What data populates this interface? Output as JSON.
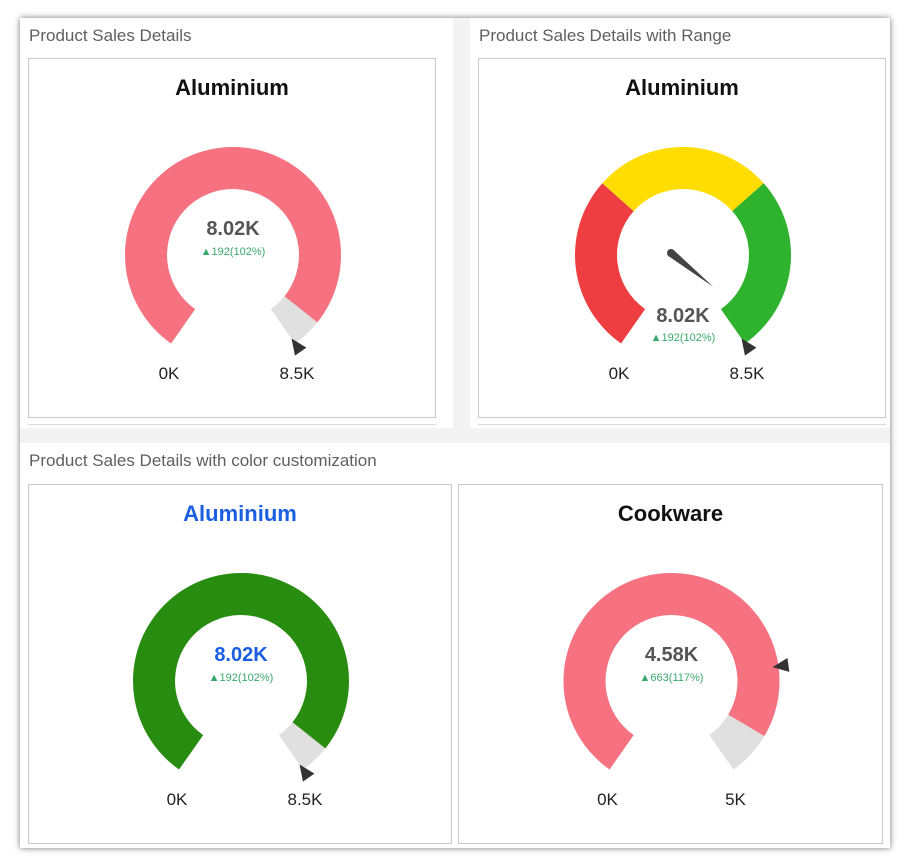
{
  "sections": [
    {
      "title": "Product Sales Details"
    },
    {
      "title": "Product Sales Details with Range"
    },
    {
      "title": "Product Sales Details with color customization"
    }
  ],
  "chart_data": [
    {
      "type": "gauge",
      "title": "Aluminium",
      "value": 8020,
      "value_label": "8.02K",
      "delta_label": "192(102%)",
      "min": 0,
      "max": 8500,
      "min_label": "0K",
      "max_label": "8.5K",
      "target": 8500,
      "fill_color": "#f67280",
      "track_color": "#e0e0e0",
      "value_color": "#555555",
      "title_color": "#111111",
      "delta_color": "#3aa86b",
      "ranges": [],
      "needle": false
    },
    {
      "type": "gauge",
      "title": "Aluminium",
      "value": 8020,
      "value_label": "8.02K",
      "delta_label": "192(102%)",
      "min": 0,
      "max": 8500,
      "min_label": "0K",
      "max_label": "8.5K",
      "target": 8500,
      "value_color": "#555555",
      "title_color": "#111111",
      "delta_color": "#3aa86b",
      "ranges": [
        {
          "from": 0,
          "to": 2833,
          "color": "#ee3e42"
        },
        {
          "from": 2833,
          "to": 5667,
          "color": "#ffdd00"
        },
        {
          "from": 5667,
          "to": 8500,
          "color": "#2fb32f"
        }
      ],
      "needle": true
    },
    {
      "type": "gauge",
      "title": "Aluminium",
      "value": 8020,
      "value_label": "8.02K",
      "delta_label": "192(102%)",
      "min": 0,
      "max": 8500,
      "min_label": "0K",
      "max_label": "8.5K",
      "target": 8500,
      "fill_color": "#288c10",
      "track_color": "#e0e0e0",
      "value_color": "#1a5fe0",
      "title_color": "#1a5fe0",
      "delta_color": "#3aa86b",
      "ranges": [],
      "needle": false
    },
    {
      "type": "gauge",
      "title": "Cookware",
      "value": 4580,
      "value_label": "4.58K",
      "delta_label": "663(117%)",
      "min": 0,
      "max": 5000,
      "min_label": "0K",
      "max_label": "5K",
      "target": 3917,
      "fill_color": "#f67280",
      "track_color": "#e0e0e0",
      "value_color": "#555555",
      "title_color": "#111111",
      "delta_color": "#3aa86b",
      "ranges": [],
      "needle": false
    }
  ]
}
